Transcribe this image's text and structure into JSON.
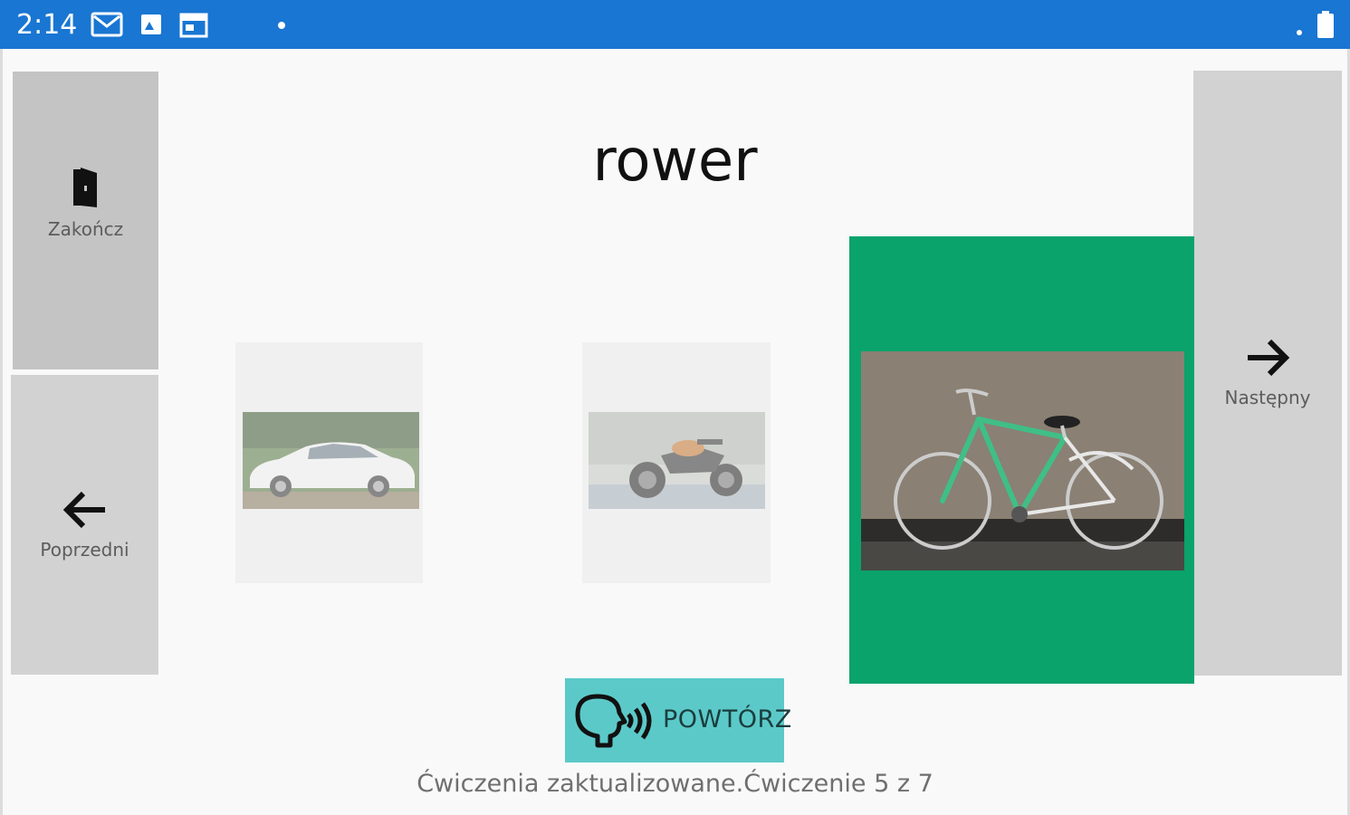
{
  "status_bar": {
    "time": "2:14",
    "icons": [
      "gmail-icon",
      "photo-icon",
      "calendar-icon",
      "dot-icon",
      "signal-icon",
      "battery-icon"
    ],
    "color": "#1976d2"
  },
  "nav": {
    "finish_label": "Zakończ",
    "finish_icon": "exit-door-icon",
    "prev_label": "Poprzedni",
    "prev_icon": "arrow-left-icon",
    "next_label": "Następny",
    "next_icon": "arrow-right-icon"
  },
  "exercise": {
    "word": "rower",
    "options": [
      {
        "id": "car",
        "image": "white car",
        "selected": false
      },
      {
        "id": "motorcycle",
        "image": "motorcycle",
        "selected": false
      },
      {
        "id": "bicycle",
        "image": "bicycle",
        "selected": true
      }
    ],
    "selected_color": "#0aa36c"
  },
  "repeat_button": {
    "label": "POWTÓRZ",
    "icon": "speaking-head-icon",
    "color": "#5cc9c9"
  },
  "status_text": "Ćwiczenia zaktualizowane.Ćwiczenie 5 z 7"
}
